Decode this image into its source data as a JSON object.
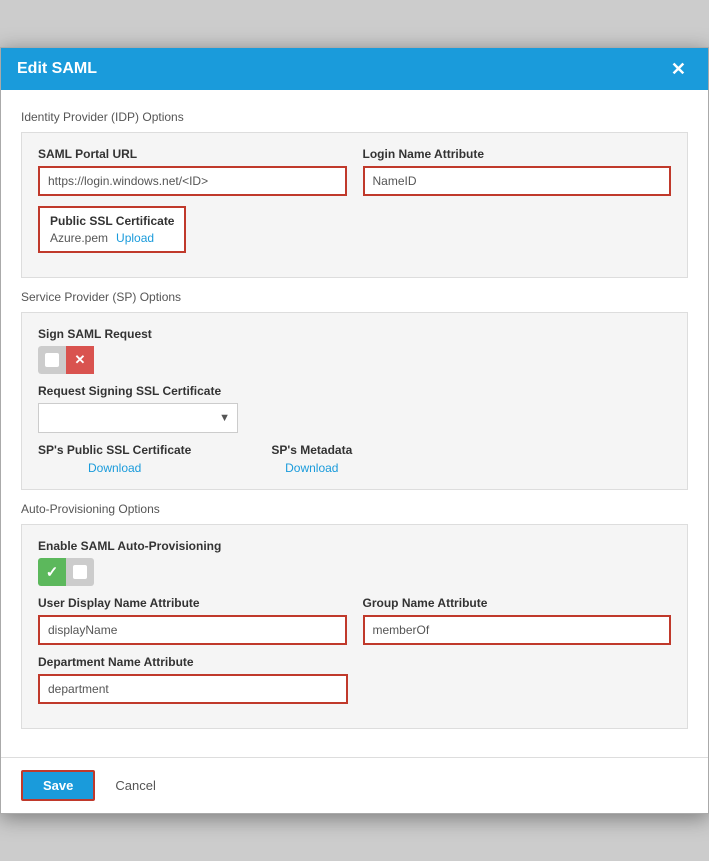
{
  "modal": {
    "title": "Edit SAML",
    "close_label": "✕"
  },
  "sections": {
    "idp_label": "Identity Provider (IDP) Options",
    "sp_label": "Service Provider (SP) Options",
    "auto_prov_label": "Auto-Provisioning Options"
  },
  "idp": {
    "saml_url_label": "SAML Portal URL",
    "saml_url_value": "https://login.windows.net/<ID>",
    "login_name_label": "Login Name Attribute",
    "login_name_value": "NameID",
    "ssl_cert_label": "Public SSL Certificate",
    "ssl_cert_file": "Azure.pem",
    "upload_label": "Upload"
  },
  "sp": {
    "sign_saml_label": "Sign SAML Request",
    "req_signing_label": "Request Signing SSL Certificate",
    "req_signing_placeholder": "",
    "public_ssl_label": "SP's Public SSL Certificate",
    "public_ssl_download": "Download",
    "metadata_label": "SP's Metadata",
    "metadata_download": "Download"
  },
  "auto_prov": {
    "enable_label": "Enable SAML Auto-Provisioning",
    "user_display_label": "User Display Name Attribute",
    "user_display_value": "displayName",
    "group_name_label": "Group Name Attribute",
    "group_name_value": "memberOf",
    "dept_name_label": "Department Name Attribute",
    "dept_name_value": "department"
  },
  "footer": {
    "save_label": "Save",
    "cancel_label": "Cancel"
  }
}
